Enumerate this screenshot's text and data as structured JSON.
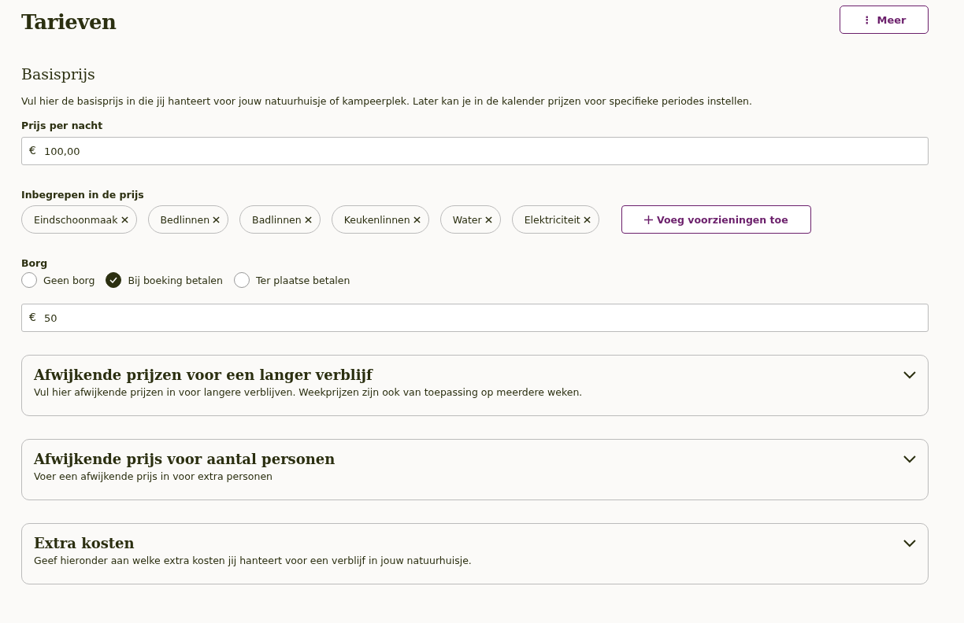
{
  "page_title": "Tarieven",
  "more_button": {
    "icon": "⋮",
    "label": "Meer"
  },
  "base_price": {
    "heading": "Basisprijs",
    "description": "Vul hier de basisprijs in die jij hanteert voor jouw natuurhuisje of kampeerplek. Later kan je in de kalender prijzen voor specifieke periodes instellen.",
    "price_label": "Prijs per nacht",
    "price_prefix": "€",
    "price_value": "100,00",
    "included_label": "Inbegrepen in de prijs",
    "included": [
      {
        "label": "Eindschoonmaak"
      },
      {
        "label": "Bedlinnen"
      },
      {
        "label": "Badlinnen"
      },
      {
        "label": "Keukenlinnen"
      },
      {
        "label": "Water"
      },
      {
        "label": "Elektriciteit"
      }
    ],
    "add_button": "Voeg voorzieningen toe",
    "deposit_label": "Borg",
    "deposit_options": [
      {
        "label": "Geen borg",
        "selected": false
      },
      {
        "label": "Bij boeking betalen",
        "selected": true
      },
      {
        "label": "Ter plaatse betalen",
        "selected": false
      }
    ],
    "deposit_prefix": "€",
    "deposit_value": "50"
  },
  "sections": [
    {
      "title": "Afwijkende prijzen voor een langer verblijf",
      "description": "Vul hier afwijkende prijzen in voor langere verblijven. Weekprijzen zijn ook van toepassing op meerdere weken.",
      "expanded": false
    },
    {
      "title": "Afwijkende prijs voor aantal personen",
      "description": "Voer een afwijkende prijs in voor extra personen",
      "expanded": false
    },
    {
      "title": "Extra kosten",
      "description": "Geef hieronder aan welke extra kosten jij hanteert voor een verblijf in jouw natuurhuisje.",
      "expanded": false
    }
  ]
}
